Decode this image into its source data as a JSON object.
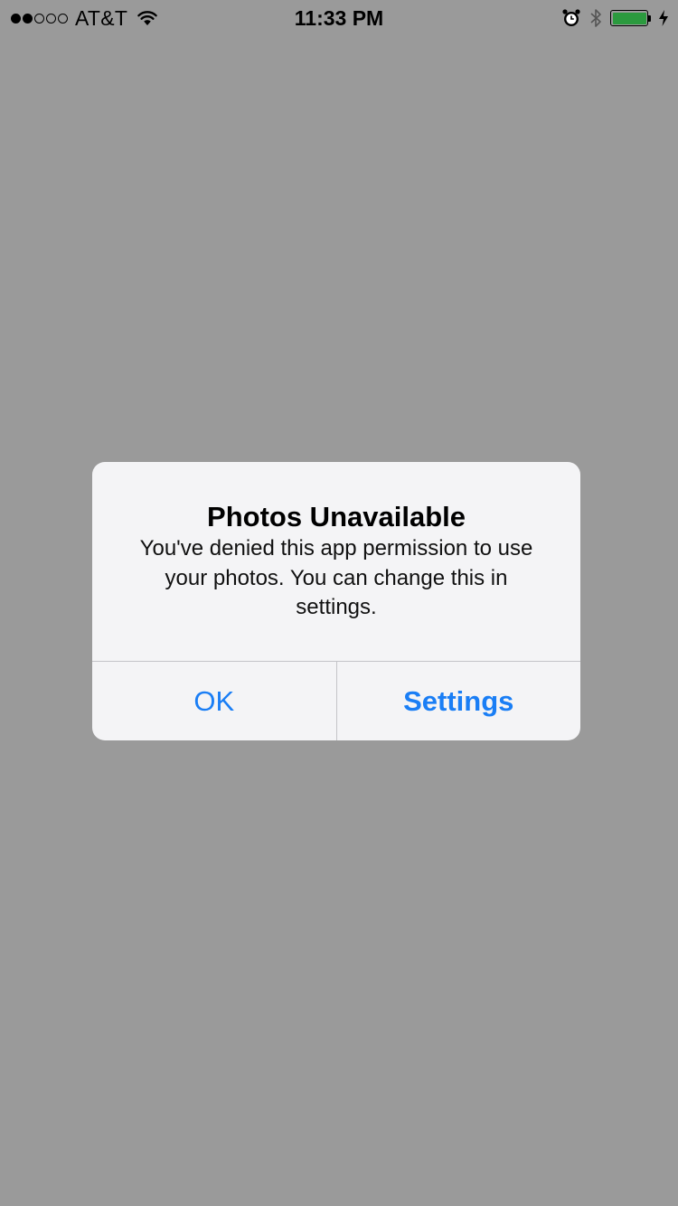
{
  "status_bar": {
    "signal_bars_filled": 2,
    "signal_bars_total": 5,
    "carrier": "AT&T",
    "time": "11:33 PM",
    "icons": [
      "wifi-icon",
      "alarm-icon",
      "bluetooth-icon",
      "battery-icon",
      "charging-bolt-icon"
    ],
    "battery_level": 1.0,
    "battery_color": "#2b9a3e"
  },
  "alert": {
    "title": "Photos Unavailable",
    "message": "You've denied this app permission to use your photos. You can change this in settings.",
    "buttons": {
      "ok_label": "OK",
      "settings_label": "Settings"
    },
    "button_color": "#1a7ef5"
  },
  "background_color": "#9a9a9a"
}
